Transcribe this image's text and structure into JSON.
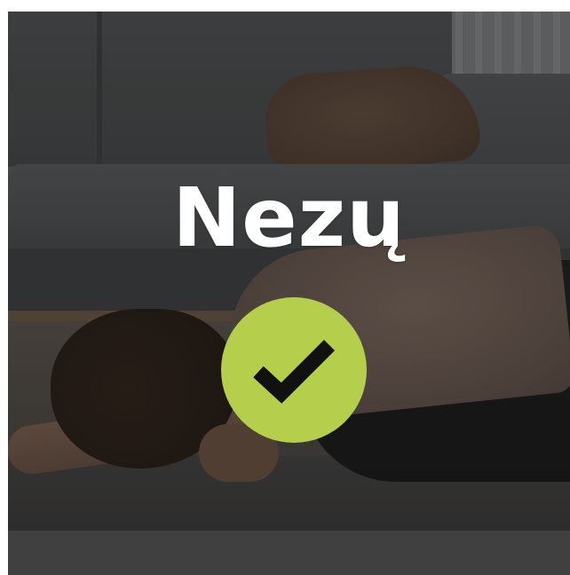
{
  "card": {
    "title": "Nezų",
    "status_icon": "checkmark-icon",
    "accent_color": "#b5cf4d",
    "checkmark_color": "#111111"
  }
}
